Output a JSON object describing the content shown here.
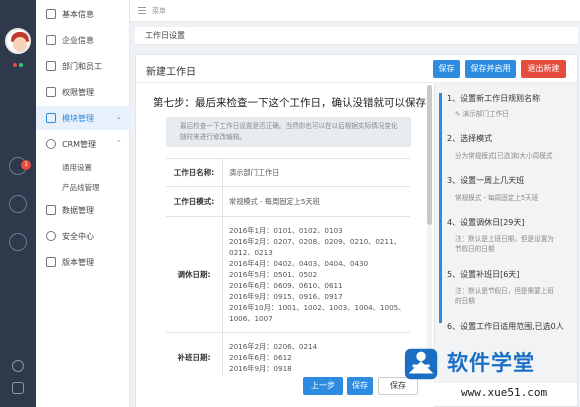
{
  "topbar": {
    "menu_label": "菜单"
  },
  "page_header": {
    "title": "工作日设置"
  },
  "sidebar": {
    "items": [
      {
        "label": "基本信息"
      },
      {
        "label": "企业信息"
      },
      {
        "label": "部门和员工"
      },
      {
        "label": "权限管理"
      },
      {
        "label": "模块管理"
      },
      {
        "label": "CRM管理"
      },
      {
        "label": "通用设置"
      },
      {
        "label": "产品线管理"
      },
      {
        "label": "数据管理"
      },
      {
        "label": "安全中心"
      },
      {
        "label": "版本管理"
      }
    ]
  },
  "rail": {
    "badge_count": "1"
  },
  "card": {
    "title": "新建工作日",
    "buttons": {
      "save": "保存",
      "save_enable": "保存并启用",
      "exit": "退出新建"
    }
  },
  "content": {
    "step_title": "第七步：最后来检查一下这个工作日，确认没错就可以保存",
    "note_line1": "最后检查一下工作日设置是否正确。当然你也可以在以后根据实际情况变化",
    "note_line2": "随时来进行修改编辑。",
    "rows": [
      {
        "label": "工作日名称:",
        "lines": [
          "演示部门工作日"
        ]
      },
      {
        "label": "工作日模式:",
        "lines": [
          "常规模式 - 每周固定上5天班"
        ]
      },
      {
        "label": "调休日期:",
        "lines": [
          "2016年1月：0101、0102、0103",
          "2016年2月：0207、0208、0209、0210、0211、",
          "0212、0213",
          "2016年4月：0402、0403、0404、0430",
          "2016年5月：0501、0502",
          "2016年6月：0609、0610、0611",
          "2016年9月：0915、0916、0917",
          "2016年10月：1001、1002、1003、1004、1005、",
          "1006、1007"
        ]
      },
      {
        "label": "补班日期:",
        "lines": [
          "2016年2月：0206、0214",
          "2016年6月：0612",
          "2016年9月：0918"
        ]
      }
    ]
  },
  "bottom": {
    "prev": "上一步",
    "save": "保存",
    "save2": "保存"
  },
  "steps": [
    {
      "title": "1、设置新工作日规则名称",
      "desc": [
        "演示部门工作日"
      ]
    },
    {
      "title": "2、选择模式",
      "desc": [
        "分为常规模式[已选]和大小周模式"
      ]
    },
    {
      "title": "3、设置一周上几天班",
      "desc": [
        "常规模式 - 每周固定上5天班"
      ]
    },
    {
      "title": "4、设置调休日[29天]",
      "desc": [
        "注：默认是上班日期，但是设置为",
        "节假日的日期"
      ]
    },
    {
      "title": "5、设置补班日[6天]",
      "desc": [
        "注：默认是节假日，但是需要上班",
        "的日期"
      ]
    },
    {
      "title": "6、设置工作日适用范围,已选0人",
      "desc": []
    }
  ],
  "watermark": {
    "brand": "软件学堂",
    "url": "www.xue51.com"
  },
  "colors": {
    "accent": "#2d8ce0",
    "danger": "#e64c3c",
    "rail": "#2e3a4c"
  }
}
